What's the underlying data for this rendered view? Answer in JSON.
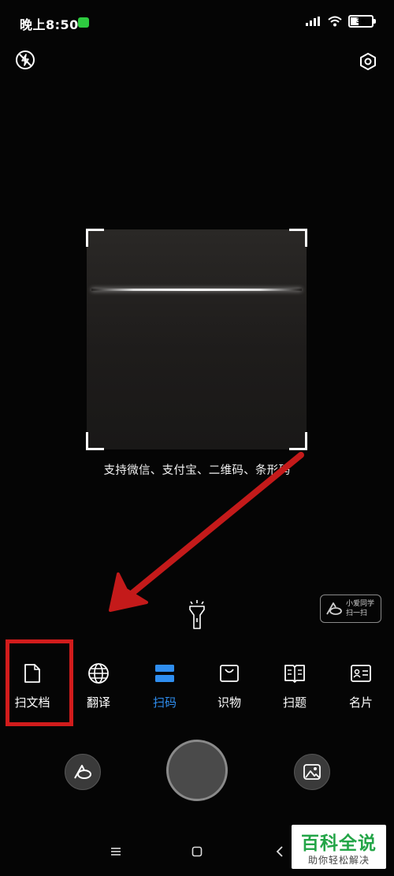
{
  "status_bar": {
    "time": "晚上8:50",
    "battery_level": "36"
  },
  "scanner": {
    "support_text": "支持微信、支付宝、二维码、条形码"
  },
  "assistant": {
    "name": "小爱同学",
    "action": "扫一扫"
  },
  "mode_tabs": [
    {
      "label": "扫文档",
      "icon": "document-icon",
      "active": false
    },
    {
      "label": "翻译",
      "icon": "globe-icon",
      "active": false
    },
    {
      "label": "扫码",
      "icon": "scan-code-icon",
      "active": true
    },
    {
      "label": "识物",
      "icon": "shopping-bag-icon",
      "active": false
    },
    {
      "label": "扫题",
      "icon": "open-book-icon",
      "active": false
    },
    {
      "label": "名片",
      "icon": "business-card-icon",
      "active": false
    }
  ],
  "colors": {
    "active_tab": "#2f8ef0",
    "annotation_red": "#d21c1c",
    "watermark_green": "#23a547"
  },
  "watermark": {
    "title": "百科全说",
    "subtitle": "助你轻松解决"
  }
}
